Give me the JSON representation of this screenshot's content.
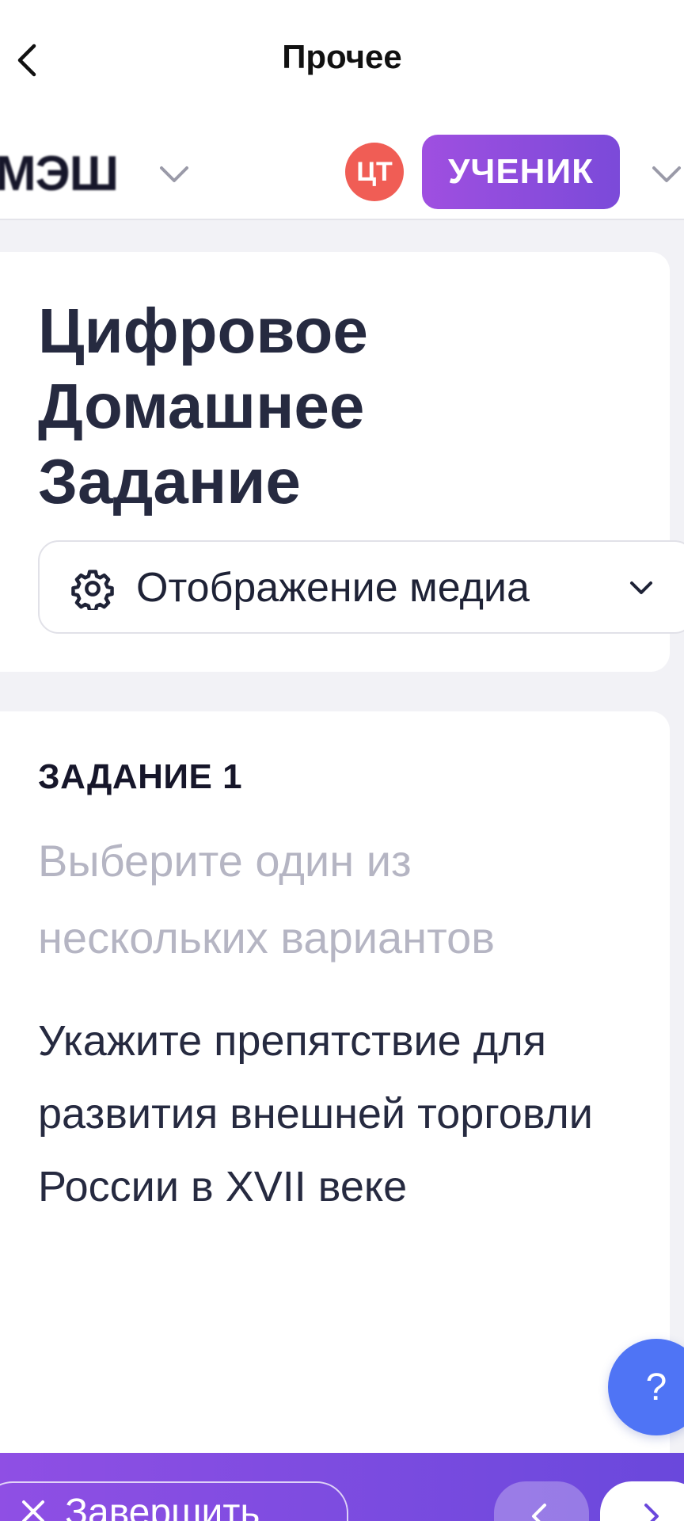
{
  "nav": {
    "title": "Прочее",
    "back_icon": "chevron-left-icon"
  },
  "header": {
    "brand": "МЭШ",
    "avatar_initials": "ЦТ",
    "role": "УЧЕНИК",
    "colors": {
      "avatar": "#f05d55",
      "role_badge": "#8b4cdd"
    }
  },
  "title_card": {
    "title": "Цифровое\nДомашнее\nЗадание",
    "media_dropdown_label": "Отображение медиа",
    "media_dropdown_icon": "gear-icon"
  },
  "task": {
    "number_label": "ЗАДАНИЕ 1",
    "hint": "Выберите один из нескольких вариантов",
    "question": "Укажите препятствие для развития внешней торговли России в XVII веке"
  },
  "help": {
    "label": "?",
    "color": "#4f74f5"
  },
  "bottom_bar": {
    "finish_label": "Завершить",
    "finish_icon": "close-icon"
  }
}
